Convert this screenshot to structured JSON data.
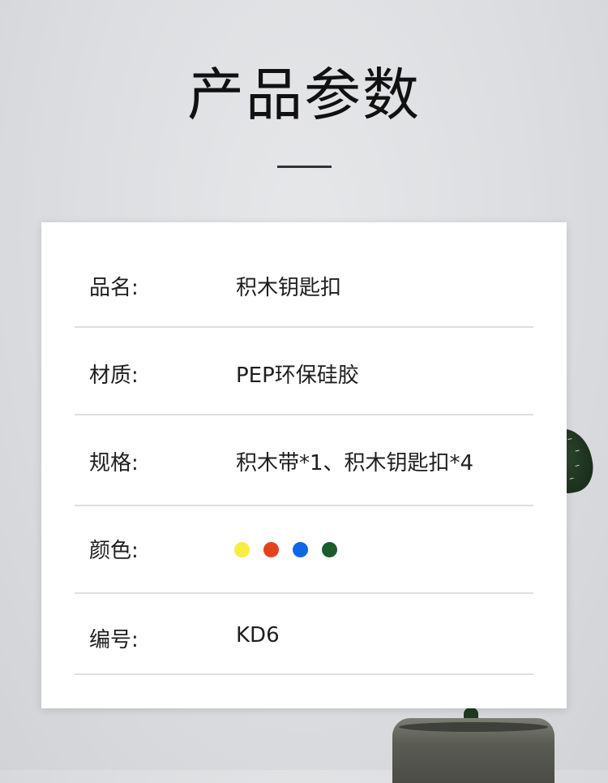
{
  "header": {
    "title": "产品参数"
  },
  "specs": {
    "name": {
      "label": "品名:",
      "value": "积木钥匙扣"
    },
    "material": {
      "label": "材质:",
      "value": "PEP环保硅胶"
    },
    "spec": {
      "label": "规格:",
      "value": "积木带*1、积木钥匙扣*4"
    },
    "color": {
      "label": "颜色:",
      "swatches": [
        "#f8ed44",
        "#e5421c",
        "#0d67e6",
        "#1a5c2b"
      ]
    },
    "code": {
      "label": "编号:",
      "value": "KD6"
    }
  }
}
